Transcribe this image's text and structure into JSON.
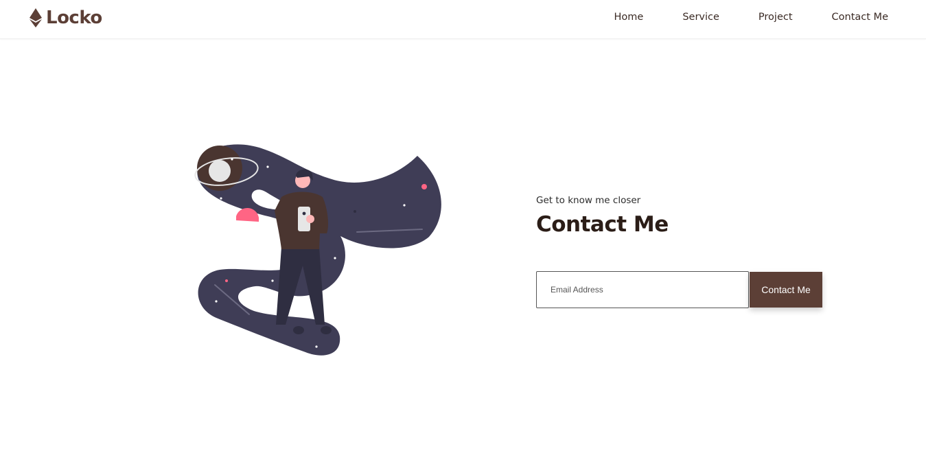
{
  "brand": {
    "name": "Locko",
    "icon": "ethereum-diamond-icon"
  },
  "nav": {
    "items": [
      {
        "label": "Home"
      },
      {
        "label": "Service"
      },
      {
        "label": "Project"
      },
      {
        "label": "Contact Me"
      }
    ]
  },
  "hero": {
    "illustration": "astronaut-with-phone-space-illustration",
    "subtitle": "Get to know me closer",
    "title": "Contact Me",
    "email_placeholder": "Email Address",
    "button_label": "Contact Me"
  },
  "colors": {
    "brand": "#5c3f36",
    "title_text": "#2b1d17",
    "space_blob": "#3f3d56",
    "accent_pink": "#ff6584",
    "planet_light": "#e6e6e6"
  }
}
